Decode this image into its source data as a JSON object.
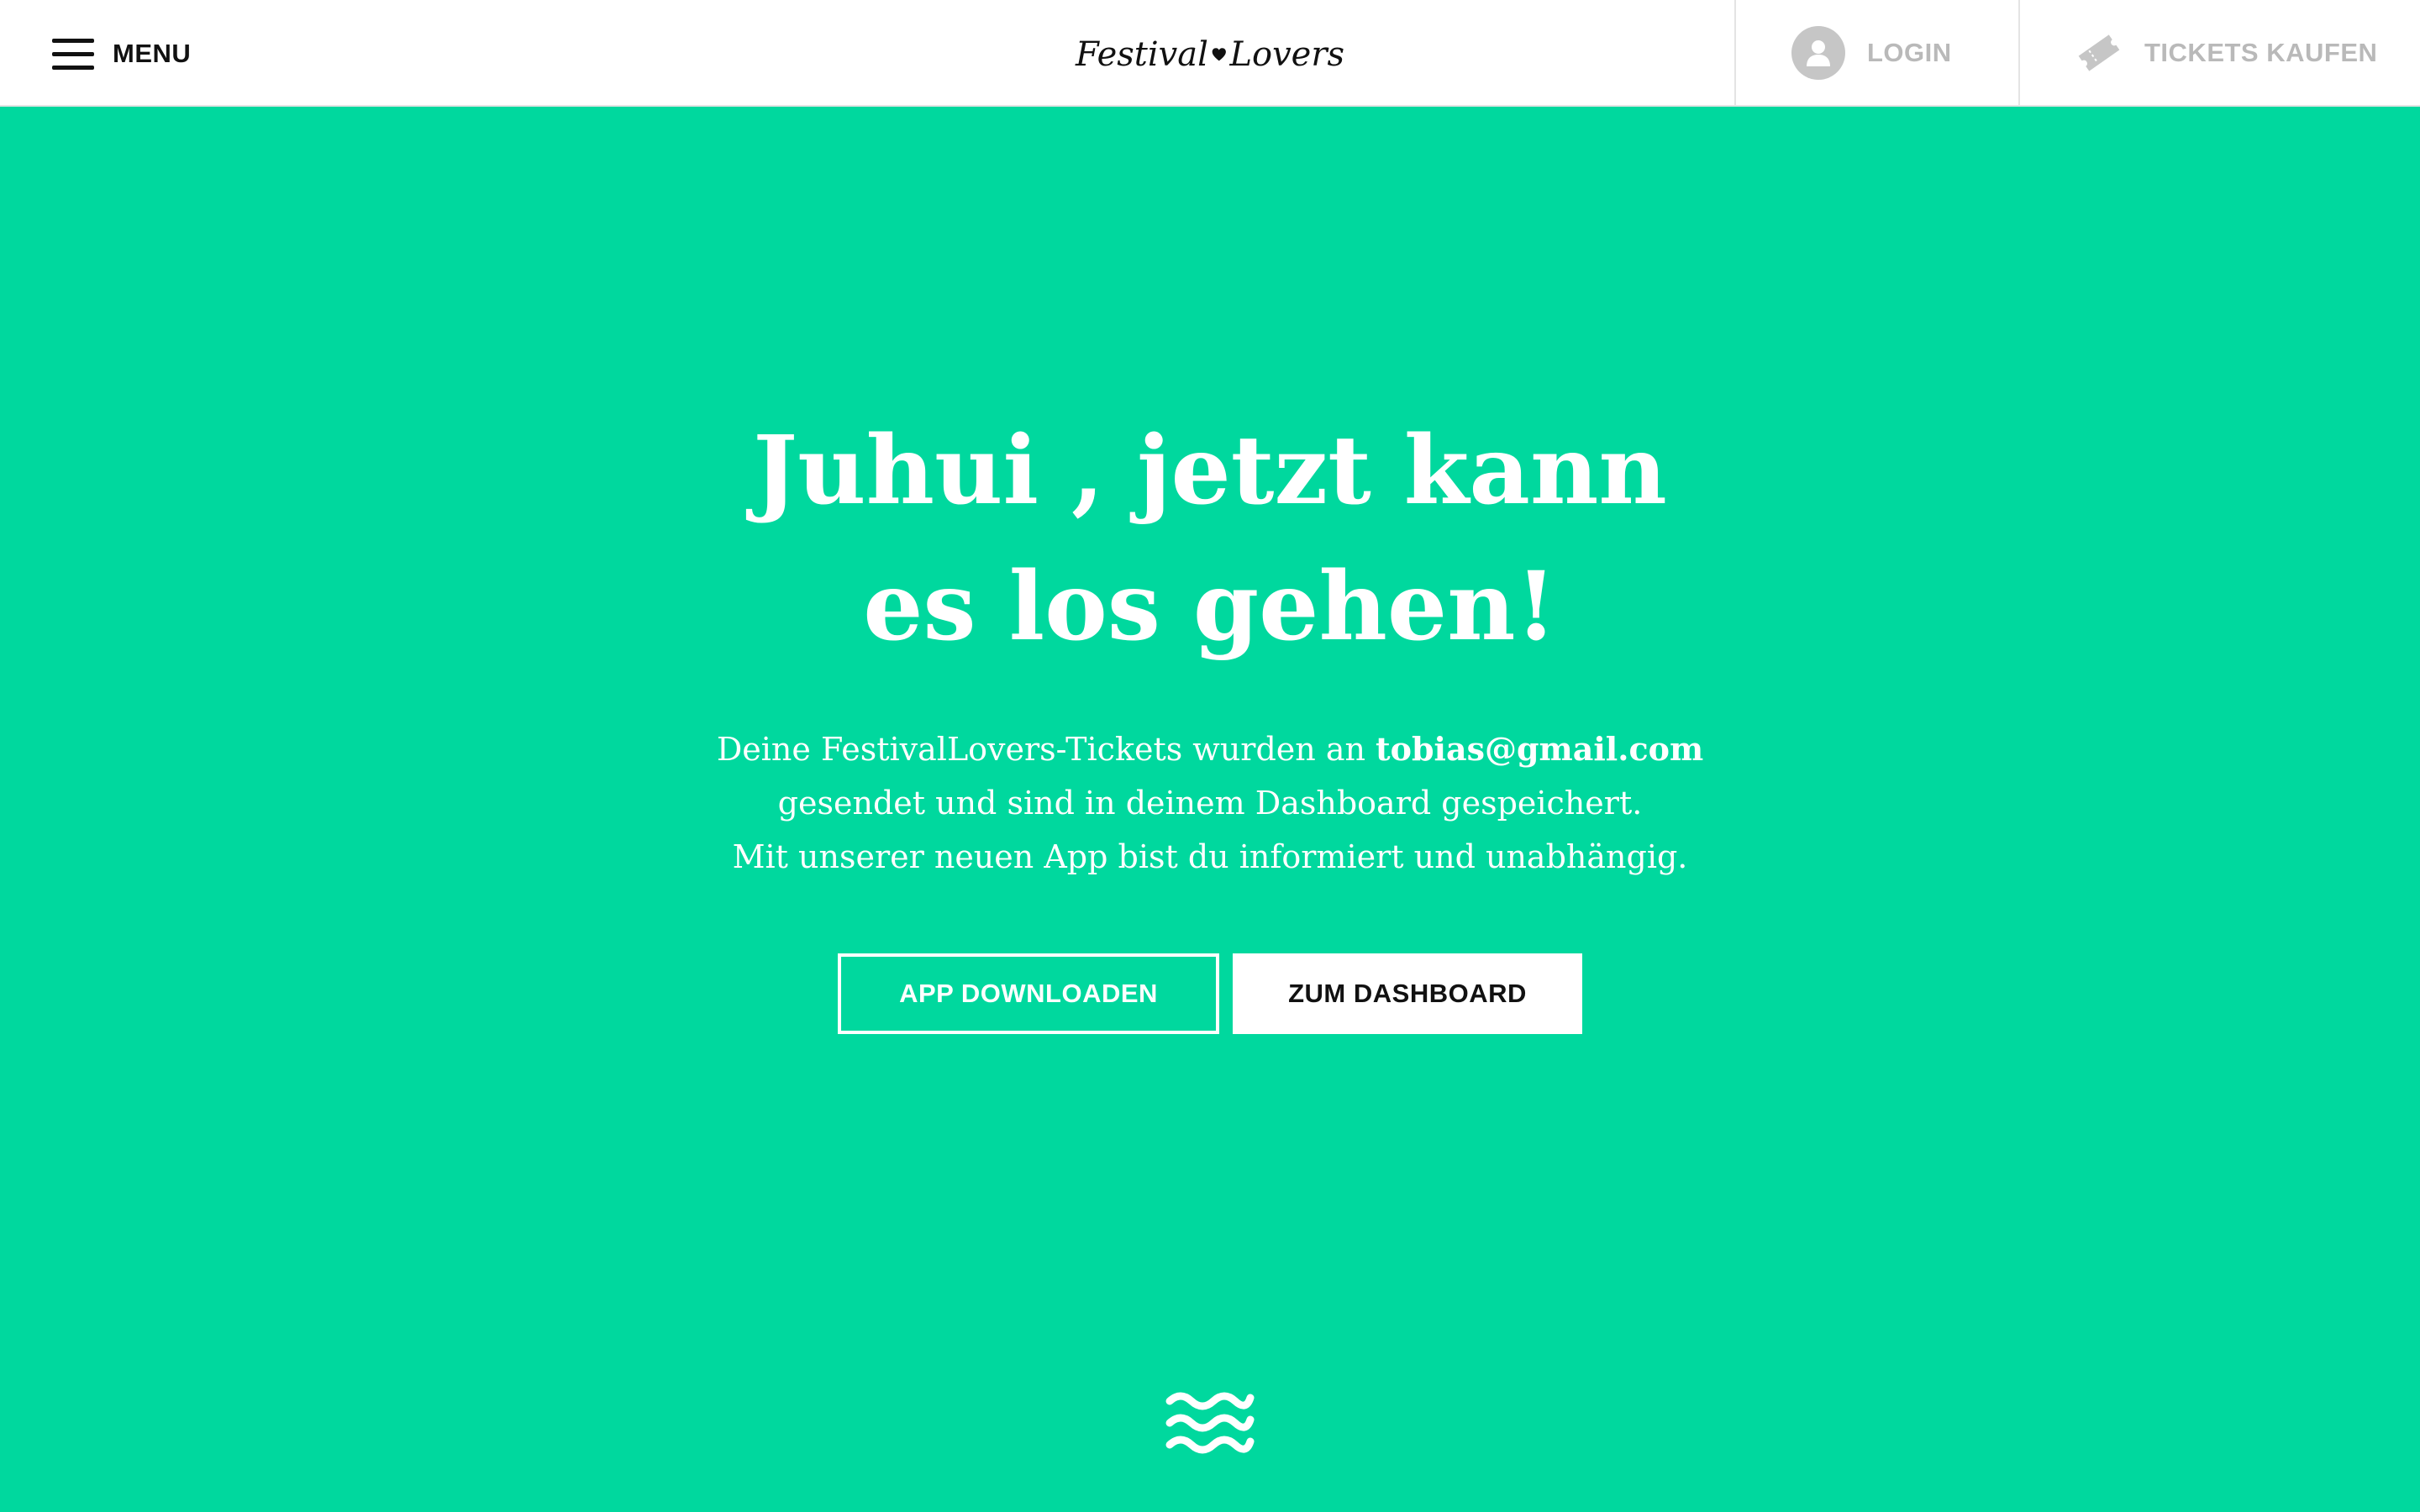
{
  "header": {
    "menu_label": "MENU",
    "logo_left": "Festival",
    "logo_right": "Lovers",
    "login_label": "LOGIN",
    "tickets_label": "TICKETS KAUFEN"
  },
  "hero": {
    "headline_line1": "Juhui , jetzt kann",
    "headline_line2": "es los gehen!",
    "text_line1_prefix": "Deine FestivalLovers-Tickets wurden an ",
    "email": "tobias@gmail.com",
    "text_line2": "gesendet und sind in deinem Dashboard gespeichert.",
    "text_line3": "Mit unserer neuen App bist du informiert und unabhängig."
  },
  "buttons": {
    "app_download": "APP DOWNLOADEN",
    "dashboard": "ZUM DASHBOARD"
  },
  "colors": {
    "accent": "#00d89e",
    "header_bg": "#ffffff",
    "muted": "#b9b9b9"
  },
  "icons": [
    "hamburger-icon",
    "heart-icon",
    "user-icon",
    "ticket-icon",
    "waves-icon"
  ]
}
